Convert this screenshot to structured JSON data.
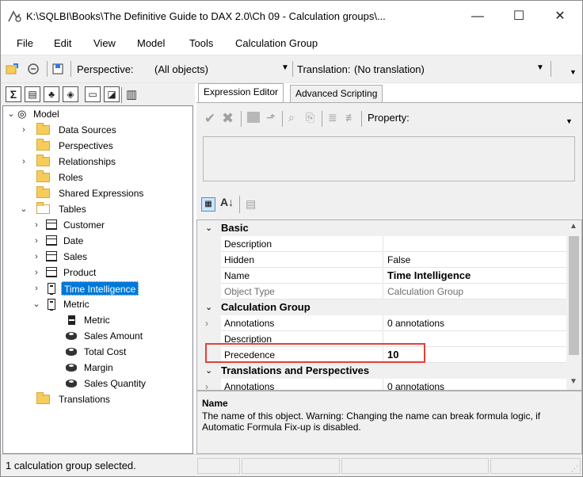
{
  "window": {
    "title": "K:\\SQLBI\\Books\\The Definitive Guide to DAX 2.0\\Ch 09 - Calculation groups\\...",
    "minimize": "—",
    "maximize": "☐",
    "close": "✕"
  },
  "menu": [
    "File",
    "Edit",
    "View",
    "Model",
    "Tools",
    "Calculation Group"
  ],
  "toolbar": {
    "perspective_label": "Perspective:",
    "perspective_value": "(All objects)",
    "translation_label": "Translation:",
    "translation_value": "(No translation)"
  },
  "tree": {
    "model": "Model",
    "data_sources": "Data Sources",
    "perspectives": "Perspectives",
    "relationships": "Relationships",
    "roles": "Roles",
    "shared_expressions": "Shared Expressions",
    "tables": "Tables",
    "customer": "Customer",
    "date": "Date",
    "sales": "Sales",
    "product": "Product",
    "time_intelligence": "Time Intelligence",
    "metric_table": "Metric",
    "metric_col": "Metric",
    "sales_amount": "Sales Amount",
    "total_cost": "Total Cost",
    "margin": "Margin",
    "sales_quantity": "Sales Quantity",
    "translations": "Translations"
  },
  "tabs": {
    "expression_editor": "Expression Editor",
    "advanced_scripting": "Advanced Scripting"
  },
  "expression_toolbar": {
    "property_label": "Property:"
  },
  "properties": {
    "cat_basic": "Basic",
    "description_label": "Description",
    "description_value": "",
    "hidden_label": "Hidden",
    "hidden_value": "False",
    "name_label": "Name",
    "name_value": "Time Intelligence",
    "object_type_label": "Object Type",
    "object_type_value": "Calculation Group",
    "cat_calc_group": "Calculation Group",
    "annotations_label": "Annotations",
    "annotations_value": "0 annotations",
    "description2_label": "Description",
    "precedence_label": "Precedence",
    "precedence_value": "10",
    "cat_translations": "Translations and Perspectives",
    "annotations2_label": "Annotations",
    "annotations2_value": "0 annotations"
  },
  "description_panel": {
    "title": "Name",
    "text": "The name of this object. Warning: Changing the name can break formula logic, if Automatic Formula Fix-up is disabled."
  },
  "status": {
    "text": "1 calculation group selected."
  },
  "colors": {
    "highlight": "#e0403a",
    "selection": "#0078d7"
  }
}
